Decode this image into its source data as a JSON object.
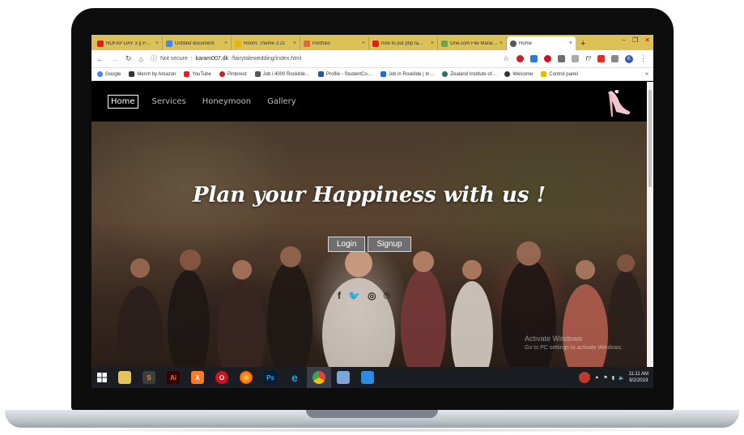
{
  "browser": {
    "tabs": [
      {
        "title": "NOFAP DAY 3 || P…",
        "favicon_color": "#e02020",
        "active": false
      },
      {
        "title": "Untitled document",
        "favicon_color": "#4285f4",
        "active": false
      },
      {
        "title": "Room: Theme 3.21",
        "favicon_color": "#e5b800",
        "active": false
      },
      {
        "title": "Portfolio",
        "favicon_color": "#e2683b",
        "active": false
      },
      {
        "title": "how to put php ta…",
        "favicon_color": "#e02020",
        "active": false
      },
      {
        "title": "One.com File Mana…",
        "favicon_color": "#6aa84f",
        "active": false
      },
      {
        "title": "Home",
        "favicon_color": "#555555",
        "active": true
      }
    ],
    "new_tab_label": "+",
    "window_controls": {
      "minimize": "–",
      "restore": "❐",
      "close": "✕"
    },
    "address": {
      "security": "Not secure",
      "domain": "karam007.dk",
      "path": "/fairytalewedding/index.html"
    },
    "profile_initial": "K",
    "bookmarks": [
      {
        "label": "Google",
        "color": "#4285f4"
      },
      {
        "label": "Merch by Amazon",
        "color": "#333333"
      },
      {
        "label": "YouTube",
        "color": "#e02020"
      },
      {
        "label": "Pinterest",
        "color": "#cb2027"
      },
      {
        "label": "Job i 4000 Roskilde…",
        "color": "#555555"
      },
      {
        "label": "Profile - StudentCo…",
        "color": "#2b5797"
      },
      {
        "label": "Job in Roskilde | In…",
        "color": "#2164f3"
      },
      {
        "label": "Zealand Institute of…",
        "color": "#2d6a6a"
      },
      {
        "label": "Welcome",
        "color": "#333333"
      },
      {
        "label": "Control panel",
        "color": "#e5b800"
      }
    ],
    "bookmarks_more": "»"
  },
  "site": {
    "nav": [
      "Home",
      "Services",
      "Honeymoon",
      "Gallery"
    ],
    "active_nav": "Home",
    "hero_title": "Plan your Happiness with us !",
    "buttons": {
      "login": "Login",
      "signup": "Signup"
    },
    "social": [
      "f",
      "t",
      "ig",
      "p"
    ]
  },
  "watermark": {
    "line1": "Activate Windows",
    "line2": "Go to PC settings to activate Windows."
  },
  "taskbar": {
    "apps": [
      {
        "name": "file-explorer",
        "label": "",
        "color": "#e8c35a"
      },
      {
        "name": "sublime-text",
        "label": "S",
        "color": "#f08d28"
      },
      {
        "name": "illustrator",
        "label": "Ai",
        "color": "#ff7c00"
      },
      {
        "name": "xampp",
        "label": "X",
        "color": "#fb7a24"
      },
      {
        "name": "opera",
        "label": "O",
        "color": "#d4101e"
      },
      {
        "name": "firefox",
        "label": "",
        "color": "#ff9500"
      },
      {
        "name": "photoshop",
        "label": "Ps",
        "color": "#31a8ff"
      },
      {
        "name": "internet-explorer",
        "label": "e",
        "color": "#1ba1e2"
      },
      {
        "name": "chrome",
        "label": "",
        "color": "#4caf50"
      },
      {
        "name": "virtualbox",
        "label": "",
        "color": "#7aa7d8"
      },
      {
        "name": "vscode",
        "label": "",
        "color": "#2b8ae2"
      }
    ],
    "time": "11:11 AM",
    "date": "9/2/2019"
  }
}
